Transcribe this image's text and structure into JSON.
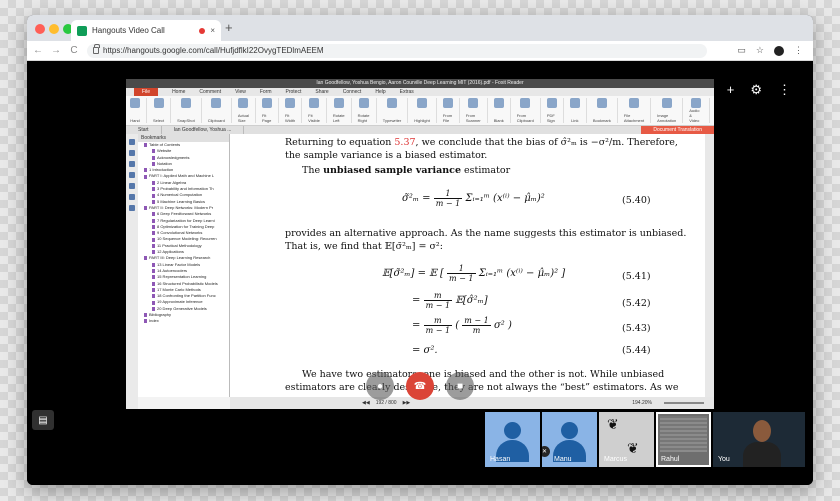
{
  "browser": {
    "tab_title": "Hangouts Video Call",
    "tab_close": "×",
    "new_tab": "+",
    "url": "https://hangouts.google.com/call/HufjdflkI22OvygTEDlmAEEM",
    "back": "←",
    "forward": "→",
    "reload": "C",
    "cast": "▭",
    "star": "☆",
    "menu": "⋮"
  },
  "hangout": {
    "add_person": "+",
    "settings": "⚙",
    "more": "⋮",
    "chat": "▤",
    "participants": [
      {
        "name": "Hasan",
        "type": "avatar",
        "muted": false
      },
      {
        "name": "Manu",
        "type": "avatar",
        "muted": true
      },
      {
        "name": "Marcus",
        "type": "paws"
      },
      {
        "name": "Rahul",
        "type": "screen",
        "selected": true
      },
      {
        "name": "You",
        "type": "camera"
      }
    ]
  },
  "shared_screen": {
    "window_title": "Ian Goodfellow, Yoshua Bengio, Aaron Courville Deep Learning MIT (2016).pdf - Foxit Reader",
    "menu": [
      "File",
      "Home",
      "Comment",
      "View",
      "Form",
      "Protect",
      "Share",
      "Connect",
      "Help",
      "Extras"
    ],
    "ribbon": [
      {
        "label": "Hand"
      },
      {
        "label": "Select"
      },
      {
        "label": "SnapShot"
      },
      {
        "label": "Clipboard"
      },
      {
        "label": "Actual Size"
      },
      {
        "label": "Fit Page"
      },
      {
        "label": "Fit Width"
      },
      {
        "label": "Fit Visible"
      },
      {
        "label": "Rotate Left"
      },
      {
        "label": "Rotate Right"
      },
      {
        "label": "Typewriter"
      },
      {
        "label": "Highlight"
      },
      {
        "label": "From File"
      },
      {
        "label": "From Scanner"
      },
      {
        "label": "Blank"
      },
      {
        "label": "From Clipboard"
      },
      {
        "label": "PDF Sign"
      },
      {
        "label": "Link"
      },
      {
        "label": "Bookmark"
      },
      {
        "label": "File Attachment"
      },
      {
        "label": "Image Annotation"
      },
      {
        "label": "Audio & Video"
      }
    ],
    "zoom_value": "194.20%",
    "doc_tabs": [
      "Start",
      "Ian Goodfellow, Yoshua ..."
    ],
    "doc_translation": "Document Translation",
    "bookmarks_header": "Bookmarks",
    "bookmarks": [
      {
        "t": "Table of Contents",
        "l": 0
      },
      {
        "t": "Website",
        "l": 1
      },
      {
        "t": "Acknowledgments",
        "l": 1
      },
      {
        "t": "Notation",
        "l": 1
      },
      {
        "t": "1 Introduction",
        "l": 0
      },
      {
        "t": "PART I: Applied Math and Machine L",
        "l": 0
      },
      {
        "t": "2 Linear Algebra",
        "l": 1
      },
      {
        "t": "3 Probability and Information Th",
        "l": 1
      },
      {
        "t": "4 Numerical Computation",
        "l": 1
      },
      {
        "t": "5 Machine Learning Basics",
        "l": 1
      },
      {
        "t": "PART II: Deep Networks: Modern Pr",
        "l": 0
      },
      {
        "t": "6 Deep Feedforward Networks",
        "l": 1
      },
      {
        "t": "7 Regularization for Deep Learni",
        "l": 1
      },
      {
        "t": "8 Optimization for Training Deep",
        "l": 1
      },
      {
        "t": "9 Convolutional Networks",
        "l": 1
      },
      {
        "t": "10 Sequence Modeling: Recurren",
        "l": 1
      },
      {
        "t": "11 Practical Methodology",
        "l": 1
      },
      {
        "t": "12 Applications",
        "l": 1
      },
      {
        "t": "PART III: Deep Learning Research",
        "l": 0
      },
      {
        "t": "13 Linear Factor Models",
        "l": 1
      },
      {
        "t": "14 Autoencoders",
        "l": 1
      },
      {
        "t": "15 Representation Learning",
        "l": 1
      },
      {
        "t": "16 Structured Probabilistic Models",
        "l": 1
      },
      {
        "t": "17 Monte Carlo Methods",
        "l": 1
      },
      {
        "t": "18 Confronting the Partition Func",
        "l": 1
      },
      {
        "t": "19 Approximate Inference",
        "l": 1
      },
      {
        "t": "20 Deep Generative Models",
        "l": 1
      },
      {
        "t": "Bibliography",
        "l": 0
      },
      {
        "t": "Index",
        "l": 0
      }
    ],
    "page": {
      "line1_a": "Returning to equation ",
      "line1_ref": "5.37",
      "line1_b": ", we conclude that the bias of σ̂²ₘ is −σ²/m. Therefore,",
      "line2": "the sample variance is a biased estimator.",
      "line3_a": "The ",
      "line3_bold": "unbiased sample variance",
      "line3_b": " estimator",
      "eq540_lhs": "σ̃²ₘ =",
      "eq540_num": "1",
      "eq540_den": "m − 1",
      "eq540_rhs": "Σᵢ₌₁ᵐ (x⁽ⁱ⁾ − μ̂ₘ)²",
      "eq540_no": "(5.40)",
      "line4": "provides an alternative approach. As the name suggests this estimator is unbiased.",
      "line5": "That is, we find that 𝔼[σ̃²ₘ] = σ²:",
      "eq541_lhs": "𝔼[σ̃²ₘ] = 𝔼",
      "eq541_num": "1",
      "eq541_den": "m − 1",
      "eq541_rhs": "Σᵢ₌₁ᵐ (x⁽ⁱ⁾ − μ̂ₘ)²",
      "eq541_no": "(5.41)",
      "eq542_num": "m",
      "eq542_den": "m − 1",
      "eq542_rhs": "𝔼[σ̂²ₘ]",
      "eq542_no": "(5.42)",
      "eq543_num": "m",
      "eq543_den": "m − 1",
      "eq543_in_num": "m − 1",
      "eq543_in_den": "m",
      "eq543_rhs": "σ²",
      "eq543_no": "(5.43)",
      "eq544": "= σ².",
      "eq544_no": "(5.44)",
      "line6": "We have two estimators: one is biased and the other is not. While unbiased",
      "line7": "estimators are clearly desirable, they are not always the “best” estimators. As we"
    },
    "status_page": "192 / 800",
    "status_zoom": "194.20%"
  },
  "call_controls": {
    "mic": "●",
    "hangup": "☎",
    "camera": "■"
  }
}
